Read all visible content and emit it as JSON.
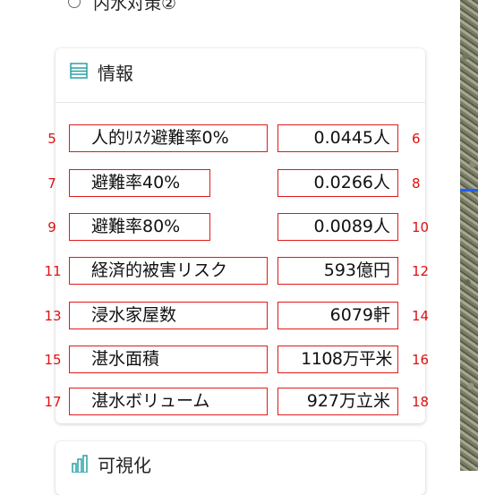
{
  "top_option": {
    "label": "内水対策②"
  },
  "info_card": {
    "title": "情報",
    "icon": "list-icon",
    "rows": [
      {
        "left_num": "5",
        "label": "人的ﾘｽｸ避難率0%",
        "value": "0.0445人",
        "right_num": "6"
      },
      {
        "left_num": "7",
        "label": "避難率40%",
        "value": "0.0266人",
        "right_num": "8"
      },
      {
        "left_num": "9",
        "label": "避難率80%",
        "value": "0.0089人",
        "right_num": "10"
      },
      {
        "left_num": "11",
        "label": "経済的被害リスク",
        "value": "593億円",
        "right_num": "12"
      },
      {
        "left_num": "13",
        "label": "浸水家屋数",
        "value": "6079軒",
        "right_num": "14"
      },
      {
        "left_num": "15",
        "label": "湛水面積",
        "value": "1108万平米",
        "right_num": "16"
      },
      {
        "left_num": "17",
        "label": "湛水ボリューム",
        "value": "927万立米",
        "right_num": "18"
      }
    ]
  },
  "viz_card": {
    "title": "可視化",
    "icon": "bar-chart-icon"
  },
  "colors": {
    "annotation": "#e01a1a",
    "accent": "#2aa0a8",
    "map_route": "#1f5fff"
  }
}
